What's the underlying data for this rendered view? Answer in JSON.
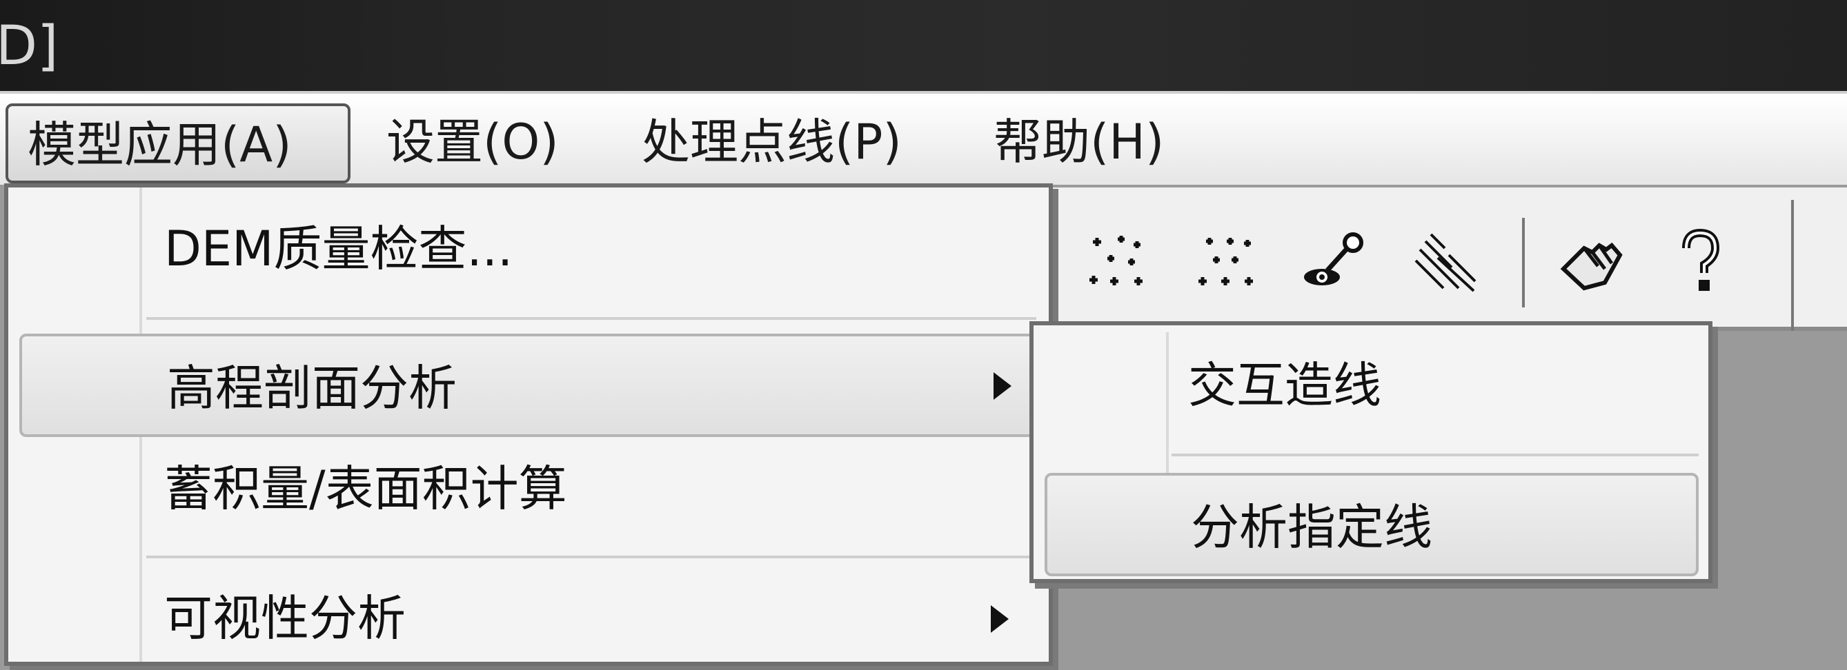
{
  "window": {
    "title_fragment": "D]"
  },
  "menubar": {
    "items": [
      {
        "label": "模型应用(A)"
      },
      {
        "label": "设置(O)"
      },
      {
        "label": "处理点线(P)"
      },
      {
        "label": "帮助(H)"
      }
    ]
  },
  "toolbar": {
    "icons": [
      "scatter-points-icon",
      "scatter-points-icon",
      "node-edit-icon",
      "hatch-lines-icon",
      "hand-icon",
      "help-icon"
    ]
  },
  "dropdown": {
    "items": [
      {
        "label": "DEM质量检查..."
      },
      {
        "label": "高程剖面分析"
      },
      {
        "label": "蓄积量/表面积计算"
      },
      {
        "label": "可视性分析"
      }
    ]
  },
  "submenu": {
    "items": [
      {
        "label": "交互造线"
      },
      {
        "label": "分析指定线"
      }
    ]
  }
}
